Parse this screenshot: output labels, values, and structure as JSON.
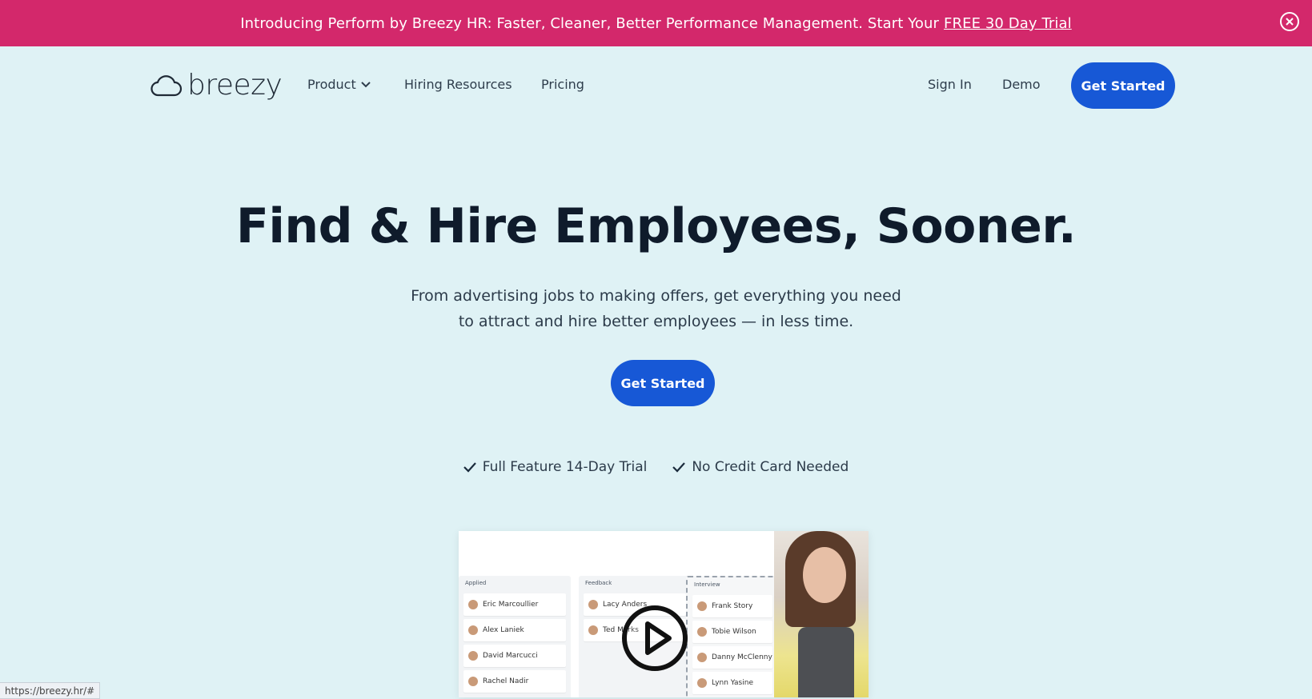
{
  "banner": {
    "text": "Introducing Perform by Breezy HR: Faster, Cleaner, Better Performance Management. Start Your",
    "link": "FREE 30 Day Trial"
  },
  "nav": {
    "logo": "breezy",
    "product": "Product",
    "hiring_resources": "Hiring Resources",
    "pricing": "Pricing",
    "sign_in": "Sign In",
    "demo": "Demo",
    "get_started": "Get Started"
  },
  "hero": {
    "title": "Find & Hire Employees, Sooner.",
    "subtitle_line1": "From advertising jobs to making offers, get everything you need",
    "subtitle_line2": "to attract and hire better employees — in less time.",
    "cta": "Get Started"
  },
  "features": [
    "Full Feature 14-Day Trial",
    "No Credit Card Needed"
  ],
  "video": {
    "columns": [
      {
        "header": "Applied",
        "cards": [
          "Eric Marcoullier",
          "Alex Laniek",
          "David Marcucci",
          "Rachel Nadir"
        ]
      },
      {
        "header": "Feedback",
        "cards": [
          "Lacy Anders",
          "Ted Marks"
        ]
      },
      {
        "header": "Interview",
        "cards": [
          "Frank Story",
          "Tobie Wilson",
          "Danny McClenny",
          "Lynn Yasine"
        ]
      }
    ]
  },
  "status_url": "https://breezy.hr/#",
  "colors": {
    "banner": "#d3286b",
    "primary": "#1758d6",
    "background": "#dff2f5"
  }
}
